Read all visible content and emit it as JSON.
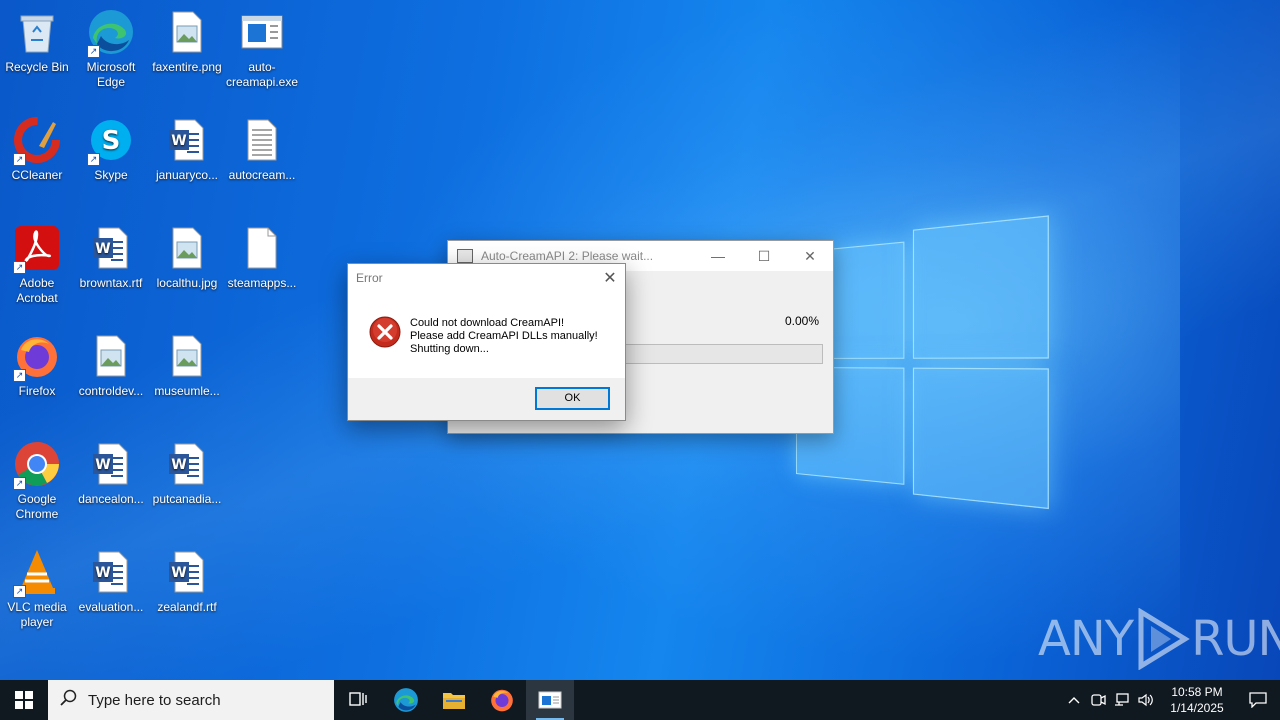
{
  "desktop": {
    "icons": [
      {
        "label": "Recycle Bin",
        "icon": "recycle-bin-icon"
      },
      {
        "label": "Microsoft Edge",
        "icon": "edge-icon"
      },
      {
        "label": "faxentire.png",
        "icon": "image-file-icon"
      },
      {
        "label": "auto-creamapi.exe",
        "icon": "exe-file-icon"
      },
      {
        "label": "CCleaner",
        "icon": "ccleaner-icon"
      },
      {
        "label": "Skype",
        "icon": "skype-icon"
      },
      {
        "label": "januaryco...",
        "icon": "word-doc-icon"
      },
      {
        "label": "autocream...",
        "icon": "text-file-icon"
      },
      {
        "label": "Adobe Acrobat",
        "icon": "acrobat-icon"
      },
      {
        "label": "browntax.rtf",
        "icon": "word-doc-icon"
      },
      {
        "label": "localthu.jpg",
        "icon": "image-file-icon"
      },
      {
        "label": "steamapps...",
        "icon": "blank-file-icon"
      },
      {
        "label": "Firefox",
        "icon": "firefox-icon"
      },
      {
        "label": "controldev...",
        "icon": "image-file-icon"
      },
      {
        "label": "museumle...",
        "icon": "image-file-icon"
      },
      {
        "label": "Google Chrome",
        "icon": "chrome-icon"
      },
      {
        "label": "dancealon...",
        "icon": "word-doc-icon"
      },
      {
        "label": "putcanadia...",
        "icon": "word-doc-icon"
      },
      {
        "label": "VLC media player",
        "icon": "vlc-icon"
      },
      {
        "label": "evaluation...",
        "icon": "word-doc-icon"
      },
      {
        "label": "zealandf.rtf",
        "icon": "word-doc-icon"
      }
    ]
  },
  "progress_window": {
    "title": "Auto-CreamAPI 2: Please wait...",
    "percent_text": "0.00%",
    "progress": 0.0
  },
  "error_dialog": {
    "title": "Error",
    "message_line1": "Could not download CreamAPI!",
    "message_line2": "Please add CreamAPI DLLs manually!",
    "message_line3": "Shutting down...",
    "ok_label": "OK"
  },
  "taskbar": {
    "search_placeholder": "Type here to search",
    "time": "10:58 PM",
    "date": "1/14/2025"
  },
  "watermark": {
    "text_left": "ANY",
    "text_right": "RUN"
  },
  "colors": {
    "accent": "#0078d7",
    "error_red": "#c42b1c",
    "taskbar": "#101820"
  }
}
